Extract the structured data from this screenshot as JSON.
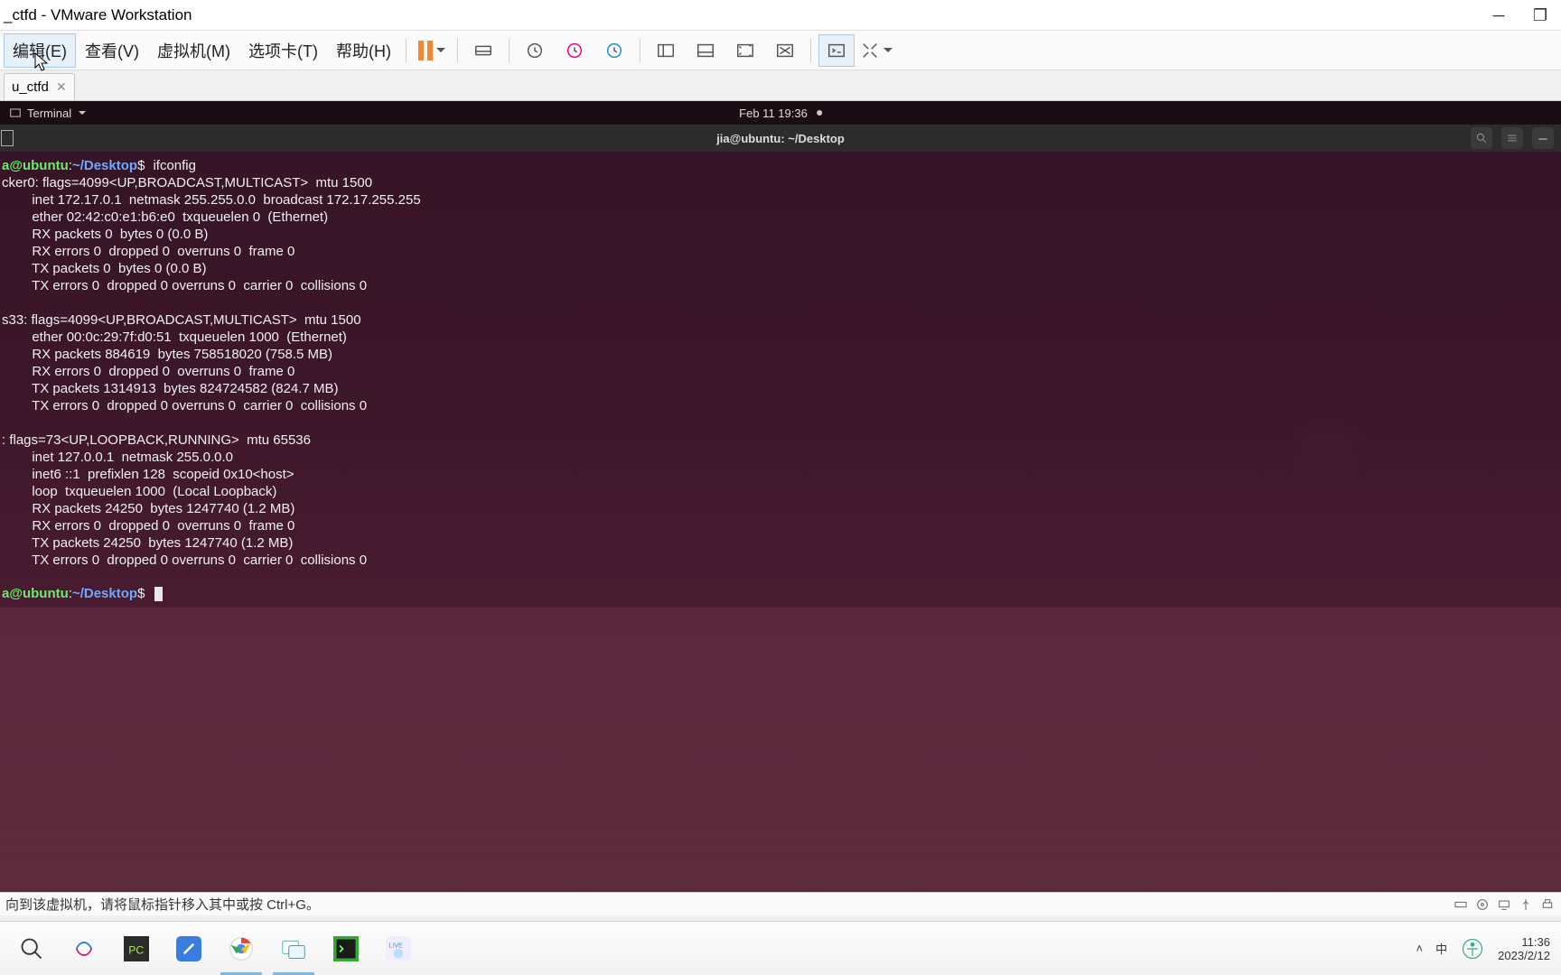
{
  "window": {
    "title": "_ctfd - VMware Workstation"
  },
  "menu": {
    "edit": "编辑(E)",
    "view": "查看(V)",
    "vm": "虚拟机(M)",
    "tabs": "选项卡(T)",
    "help": "帮助(H)"
  },
  "vm_tab": {
    "name": "u_ctfd"
  },
  "gnome": {
    "activities": "Terminal",
    "datetime": "Feb 11  19:36"
  },
  "terminal": {
    "title": "jia@ubuntu: ~/Desktop",
    "prompt_user": "a@ubuntu",
    "prompt_sep": ":",
    "prompt_path": "~/Desktop",
    "prompt_sym": "$",
    "cmd1": "ifconfig",
    "output": "cker0: flags=4099<UP,BROADCAST,MULTICAST>  mtu 1500\n        inet 172.17.0.1  netmask 255.255.0.0  broadcast 172.17.255.255\n        ether 02:42:c0:e1:b6:e0  txqueuelen 0  (Ethernet)\n        RX packets 0  bytes 0 (0.0 B)\n        RX errors 0  dropped 0  overruns 0  frame 0\n        TX packets 0  bytes 0 (0.0 B)\n        TX errors 0  dropped 0 overruns 0  carrier 0  collisions 0\n\ns33: flags=4099<UP,BROADCAST,MULTICAST>  mtu 1500\n        ether 00:0c:29:7f:d0:51  txqueuelen 1000  (Ethernet)\n        RX packets 884619  bytes 758518020 (758.5 MB)\n        RX errors 0  dropped 0  overruns 0  frame 0\n        TX packets 1314913  bytes 824724582 (824.7 MB)\n        TX errors 0  dropped 0 overruns 0  carrier 0  collisions 0\n\n: flags=73<UP,LOOPBACK,RUNNING>  mtu 65536\n        inet 127.0.0.1  netmask 255.0.0.0\n        inet6 ::1  prefixlen 128  scopeid 0x10<host>\n        loop  txqueuelen 1000  (Local Loopback)\n        RX packets 24250  bytes 1247740 (1.2 MB)\n        RX errors 0  dropped 0  overruns 0  frame 0\n        TX packets 24250  bytes 1247740 (1.2 MB)\n        TX errors 0  dropped 0 overruns 0  carrier 0  collisions 0\n"
  },
  "statusbar": {
    "hint": "向到该虚拟机，请将鼠标指针移入其中或按 Ctrl+G。"
  },
  "tray": {
    "time": "11:36",
    "date": "2023/2/12"
  }
}
